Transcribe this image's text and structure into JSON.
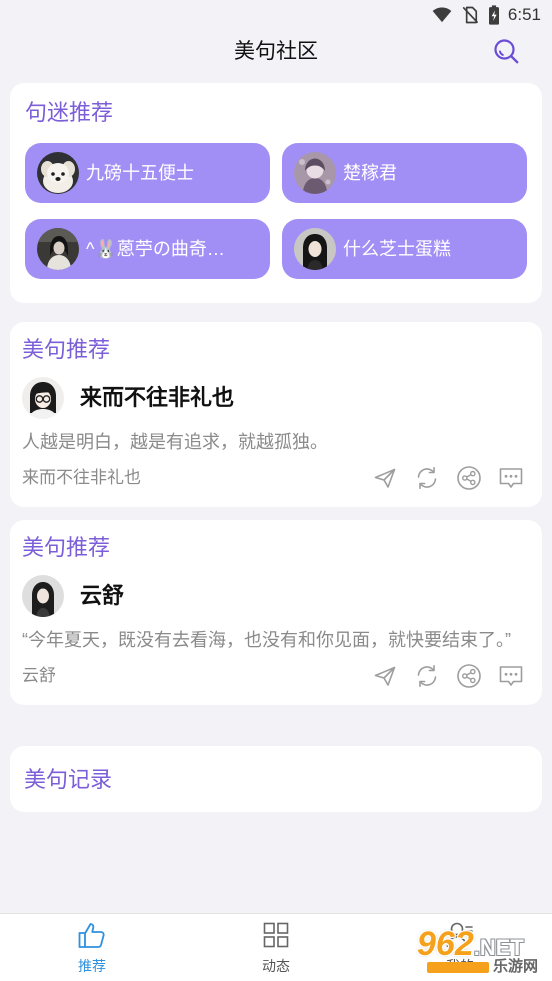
{
  "status_bar": {
    "time": "6:51",
    "icons": [
      "wifi-icon",
      "no-sim-icon",
      "battery-charging-icon"
    ]
  },
  "header": {
    "title": "美句社区",
    "search_icon": "search-icon"
  },
  "recommended_users": {
    "title": "句迷推荐",
    "users": [
      {
        "name": "九磅十五便士"
      },
      {
        "name": "楚稼君"
      },
      {
        "name": "^🐰蒽苧の曲奇…"
      },
      {
        "name": "什么芝士蛋糕"
      }
    ]
  },
  "posts": [
    {
      "section_title": "美句推荐",
      "author": "来而不往非礼也",
      "quote": "人越是明白，越是有追求，就越孤独。",
      "source": "来而不往非礼也",
      "actions": [
        "send-icon",
        "refresh-icon",
        "share-icon",
        "comment-icon"
      ]
    },
    {
      "section_title": "美句推荐",
      "author": "云舒",
      "quote": "“今年夏天，既没有去看海，也没有和你见面，就快要结束了。”",
      "source": "云舒",
      "actions": [
        "send-icon",
        "refresh-icon",
        "share-icon",
        "comment-icon"
      ]
    }
  ],
  "records": {
    "title": "美句记录"
  },
  "bottom_nav": {
    "items": [
      {
        "label": "推荐",
        "icon": "thumbs-up-icon",
        "active": true
      },
      {
        "label": "动态",
        "icon": "grid-icon",
        "active": false
      },
      {
        "label": "我的",
        "icon": "person-icon",
        "active": false
      }
    ]
  },
  "watermark": {
    "number": "962",
    "suffix": ".NET",
    "name": "乐游网"
  },
  "colors": {
    "background": "#f2f2f7",
    "accent_purple": "#7b5ed8",
    "button_purple": "#a28ff6",
    "search_purple": "#6a4cd6",
    "nav_active": "#2f90dc",
    "secondary_text": "#8a8a8a"
  }
}
